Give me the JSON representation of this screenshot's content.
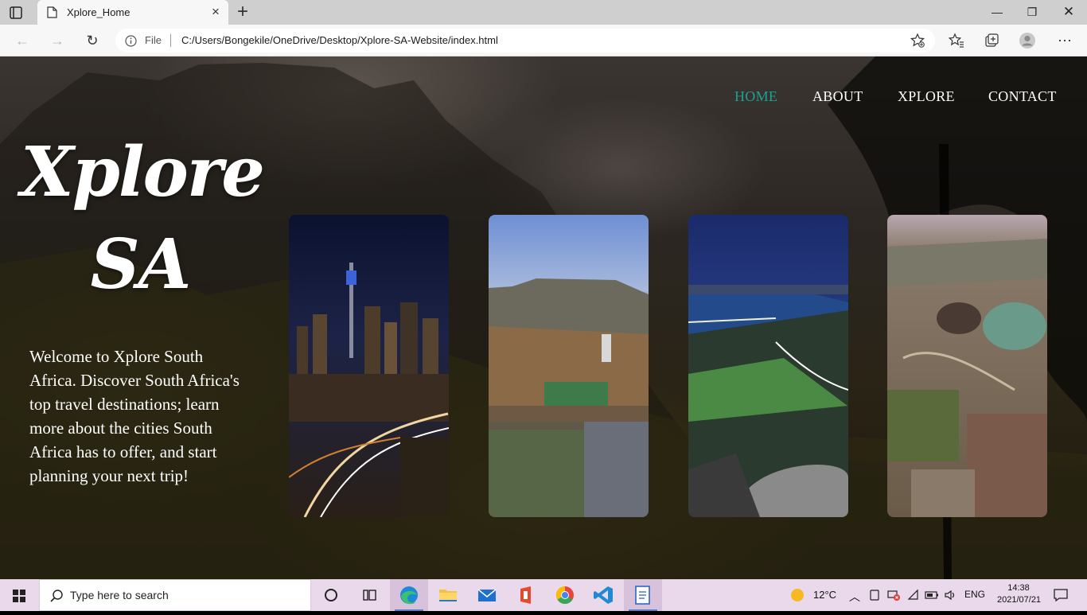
{
  "browser": {
    "tab_title": "Xplore_Home",
    "url_scheme": "File",
    "url": "C:/Users/Bongekile/OneDrive/Desktop/Xplore-SA-Website/index.html"
  },
  "site": {
    "nav": [
      {
        "label": "HOME"
      },
      {
        "label": "ABOUT"
      },
      {
        "label": "XPLORE"
      },
      {
        "label": "CONTACT"
      }
    ],
    "logo_line1": "Xplore",
    "logo_line2": "SA",
    "welcome": "Welcome to Xplore South Africa. Discover South Africa's top travel destinations; learn more about the cities South Africa has to offer, and start planning your next trip!",
    "active_color": "#1aa393"
  },
  "taskbar": {
    "search_placeholder": "Type here to search",
    "weather": "12°C",
    "language": "ENG",
    "time": "14:38",
    "date": "2021/07/21"
  }
}
